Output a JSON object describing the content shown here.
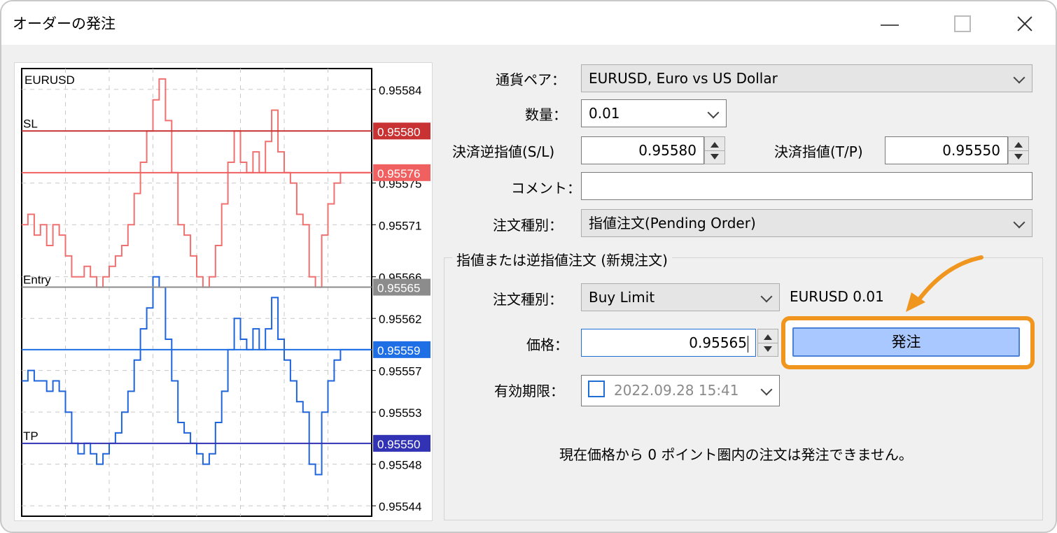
{
  "window": {
    "title": "オーダーの発注"
  },
  "form": {
    "currency_pair": {
      "label": "通貨ペア：",
      "value": "EURUSD, Euro vs US Dollar"
    },
    "quantity": {
      "label": "数量：",
      "value": "0.01"
    },
    "stop_loss": {
      "label": "決済逆指値(S/L)",
      "value": "0.95580"
    },
    "take_profit": {
      "label": "決済指値(T/P)",
      "value": "0.95550"
    },
    "comment": {
      "label": "コメント：",
      "value": ""
    },
    "order_type": {
      "label": "注文種別：",
      "value": "指値注文(Pending Order)"
    }
  },
  "pending": {
    "group_title": "指値または逆指値注文 (新規注文)",
    "order_type_label": "注文種別：",
    "order_type_value": "Buy Limit",
    "symbol_qty": "EURUSD 0.01",
    "price_label": "価格：",
    "price_value": "0.95565",
    "submit_label": "発注",
    "expiry_label": "有効期限：",
    "expiry_value": "2022.09.28 15:41",
    "expiry_checked": false,
    "note": "現在価格から 0 ポイント圏内の注文は発注できません。"
  },
  "chart_data": {
    "type": "line",
    "title": "EURUSD",
    "ylim": [
      0.95543,
      0.95586
    ],
    "y_ticks": [
      "0.95584",
      "0.95575",
      "0.95571",
      "0.95566",
      "0.95562",
      "0.95557",
      "0.95553",
      "0.95548",
      "0.95544"
    ],
    "series": [
      {
        "name": "",
        "color": "#f07070",
        "values": [
          0.95571,
          0.95572,
          0.9557,
          0.95571,
          0.95569,
          0.95571,
          0.9557,
          0.95568,
          0.95566,
          0.95566,
          0.95567,
          0.95566,
          0.95565,
          0.95566,
          0.95567,
          0.95568,
          0.95569,
          0.95571,
          0.95574,
          0.95577,
          0.9558,
          0.95583,
          0.95585,
          0.95581,
          0.95576,
          0.95571,
          0.9557,
          0.95568,
          0.95566,
          0.95565,
          0.95566,
          0.95569,
          0.95573,
          0.95577,
          0.9558,
          0.95577,
          0.95576,
          0.95578,
          0.95576,
          0.95579,
          0.95582,
          0.95578,
          0.95576,
          0.95575,
          0.95572,
          0.95571,
          0.95566,
          0.95565,
          0.9557,
          0.95573,
          0.95575,
          0.95576,
          0.95576,
          0.95576,
          0.95576,
          0.95576
        ]
      },
      {
        "name": "",
        "color": "#1e64dc",
        "values": [
          0.95556,
          0.95557,
          0.95556,
          0.95556,
          0.95555,
          0.95556,
          0.95555,
          0.95553,
          0.9555,
          0.95549,
          0.9555,
          0.95549,
          0.95548,
          0.95549,
          0.9555,
          0.95551,
          0.95553,
          0.95555,
          0.95558,
          0.95561,
          0.95563,
          0.95566,
          0.95565,
          0.9556,
          0.95556,
          0.95552,
          0.95551,
          0.9555,
          0.95549,
          0.95548,
          0.95549,
          0.95552,
          0.95555,
          0.95559,
          0.95562,
          0.9556,
          0.95559,
          0.95561,
          0.95559,
          0.95561,
          0.95564,
          0.9556,
          0.95558,
          0.95556,
          0.95554,
          0.95553,
          0.95548,
          0.95547,
          0.95553,
          0.95556,
          0.95558,
          0.95559,
          0.95559,
          0.95559,
          0.95559,
          0.95559
        ]
      }
    ],
    "levels": [
      {
        "label": "SL",
        "value": 0.9558,
        "price": "0.95580",
        "color": "#c83232"
      },
      {
        "label": "",
        "value": 0.95576,
        "price": "0.95576",
        "color": "#f06060"
      },
      {
        "label": "Entry",
        "value": 0.95565,
        "price": "0.95565",
        "color": "#8c8c8c"
      },
      {
        "label": "",
        "value": 0.95559,
        "price": "0.95559",
        "color": "#1e6ee6"
      },
      {
        "label": "TP",
        "value": 0.9555,
        "price": "0.95550",
        "color": "#3232b4"
      }
    ]
  }
}
